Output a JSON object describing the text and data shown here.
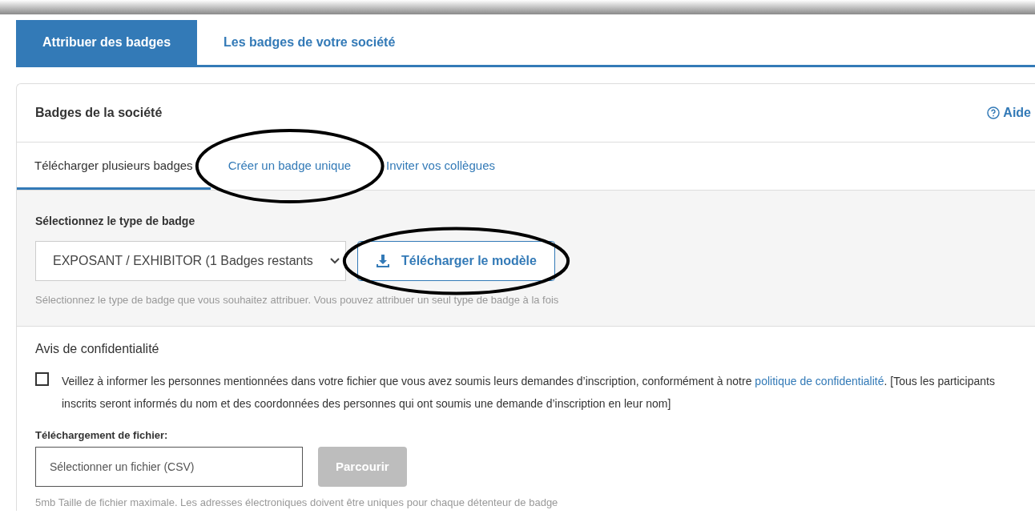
{
  "tabs": [
    {
      "label": "Attribuer des badges",
      "selected": true
    },
    {
      "label": "Les badges de votre société",
      "selected": false
    }
  ],
  "card": {
    "title": "Badges de la société",
    "help_link": "Aide"
  },
  "sub_tabs": [
    {
      "label": "Télécharger plusieurs badges",
      "selected": true,
      "circled": false
    },
    {
      "label": "Créer un badge unique",
      "selected": false,
      "circled": true
    },
    {
      "label": "Inviter vos collègues",
      "selected": false,
      "circled": false
    }
  ],
  "badge_type": {
    "label": "Sélectionnez le type de badge",
    "value": "EXPOSANT / EXHIBITOR (1 Badges restants",
    "template_button": {
      "label": "Télécharger le modèle",
      "circled": true
    },
    "hint": "Sélectionnez le type de badge que vous souhaitez attribuer. Vous pouvez attribuer un seul type de badge à la fois"
  },
  "privacy": {
    "title": "Avis de confidentialité",
    "checked": false,
    "text_before": "Veillez à informer les personnes mentionnées dans votre fichier que vous avez soumis leurs demandes d’inscription, conformément à notre ",
    "link": "politique de confidentialité",
    "text_after": ". [Tous les participants inscrits seront informés du nom et des coordonnées des personnes qui ont soumis une demande d’inscription en leur nom]"
  },
  "upload": {
    "label": "Téléchargement de fichier:",
    "placeholder": "Sélectionner un fichier (CSV)",
    "browse_button": {
      "label": "Parcourir",
      "disabled": true
    },
    "hint": "5mb Taille de fichier maximale. Les adresses électroniques doivent être uniques pour chaque détenteur de badge"
  }
}
